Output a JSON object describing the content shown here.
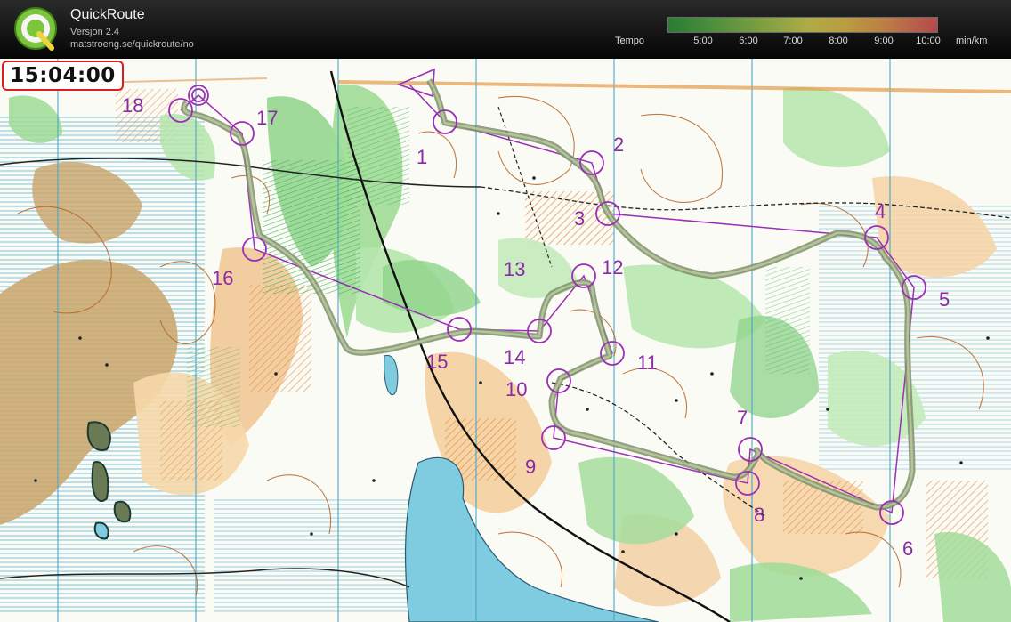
{
  "app": {
    "title": "QuickRoute",
    "version": "Versjon 2.4",
    "url": "matstroeng.se/quickroute/no"
  },
  "tempo": {
    "label": "Tempo",
    "ticks": [
      "5:00",
      "6:00",
      "7:00",
      "8:00",
      "9:00",
      "10:00"
    ],
    "unit": "min/km"
  },
  "clock": "15:04:00",
  "map": {
    "controls": [
      {
        "label": "1"
      },
      {
        "label": "2"
      },
      {
        "label": "3"
      },
      {
        "label": "4"
      },
      {
        "label": "5"
      },
      {
        "label": "6"
      },
      {
        "label": "7"
      },
      {
        "label": "8"
      },
      {
        "label": "9"
      },
      {
        "label": "10"
      },
      {
        "label": "11"
      },
      {
        "label": "12"
      },
      {
        "label": "13"
      },
      {
        "label": "14"
      },
      {
        "label": "15"
      },
      {
        "label": "16"
      },
      {
        "label": "17"
      },
      {
        "label": "18"
      }
    ]
  },
  "colors": {
    "course": "#9b2fb5",
    "route": "#7f8f6a",
    "water": "#7fcbe0",
    "open_land": "#e8b87a",
    "forest_green": "#8fd38a",
    "clock_border": "#e01b1b"
  }
}
